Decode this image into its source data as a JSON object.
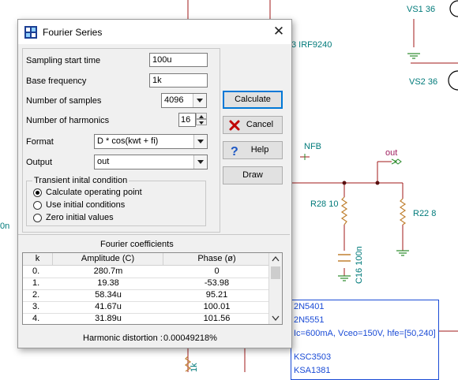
{
  "schematic": {
    "labels": {
      "vs1": "VS1 36",
      "vs2": "VS2 36",
      "irf": "3 IRF9240",
      "nfb": "NFB",
      "out": "out",
      "r28": "R28 10",
      "r22": "R22 8",
      "c16": "C16 100n",
      "left_frag": "0n",
      "bottom_frag": "1k"
    },
    "info_lines": [
      "2N5401",
      "2N5551",
      "Ic=600mA, Vceo=150V, hfe=[50,240]",
      "",
      "KSC3503",
      "KSA1381"
    ]
  },
  "dialog": {
    "title": "Fourier Series",
    "close_glyph": "✕",
    "fields": {
      "sampling_start": {
        "label": "Sampling start time",
        "value": "100u"
      },
      "base_frequency": {
        "label": "Base frequency",
        "value": "1k"
      },
      "num_samples": {
        "label": "Number of samples",
        "value": "4096"
      },
      "num_harmonics": {
        "label": "Number of harmonics",
        "value": "16"
      },
      "format": {
        "label": "Format",
        "value": "D * cos(kwt + fi)"
      },
      "output": {
        "label": "Output",
        "value": "out"
      }
    },
    "transient": {
      "legend": "Transient inital condition",
      "options": [
        {
          "label": "Calculate operating point",
          "checked": true
        },
        {
          "label": "Use initial conditions",
          "checked": false
        },
        {
          "label": "Zero initial values",
          "checked": false
        }
      ]
    },
    "buttons": {
      "calculate": "Calculate",
      "cancel": "Cancel",
      "help": "Help",
      "draw": "Draw"
    },
    "coefficients": {
      "title": "Fourier coefficients",
      "headers": [
        "k",
        "Amplitude (C)",
        "Phase (ø)"
      ],
      "rows": [
        [
          "0.",
          "280.7m",
          "0"
        ],
        [
          "1.",
          "19.38",
          "-53.98"
        ],
        [
          "2.",
          "58.34u",
          "95.21"
        ],
        [
          "3.",
          "41.67u",
          "100.01"
        ],
        [
          "4.",
          "31.89u",
          "101.56"
        ]
      ]
    },
    "distortion": {
      "label": "Harmonic distortion :",
      "value": "0.00049218%"
    }
  },
  "colors": {
    "wire": "#a01a1a",
    "node": "#5a1010",
    "component": "#c08030",
    "ground": "#2a8a2a",
    "text_teal": "#007a7a",
    "text_blue": "#1a4bd6",
    "accent": "#0078d7"
  }
}
